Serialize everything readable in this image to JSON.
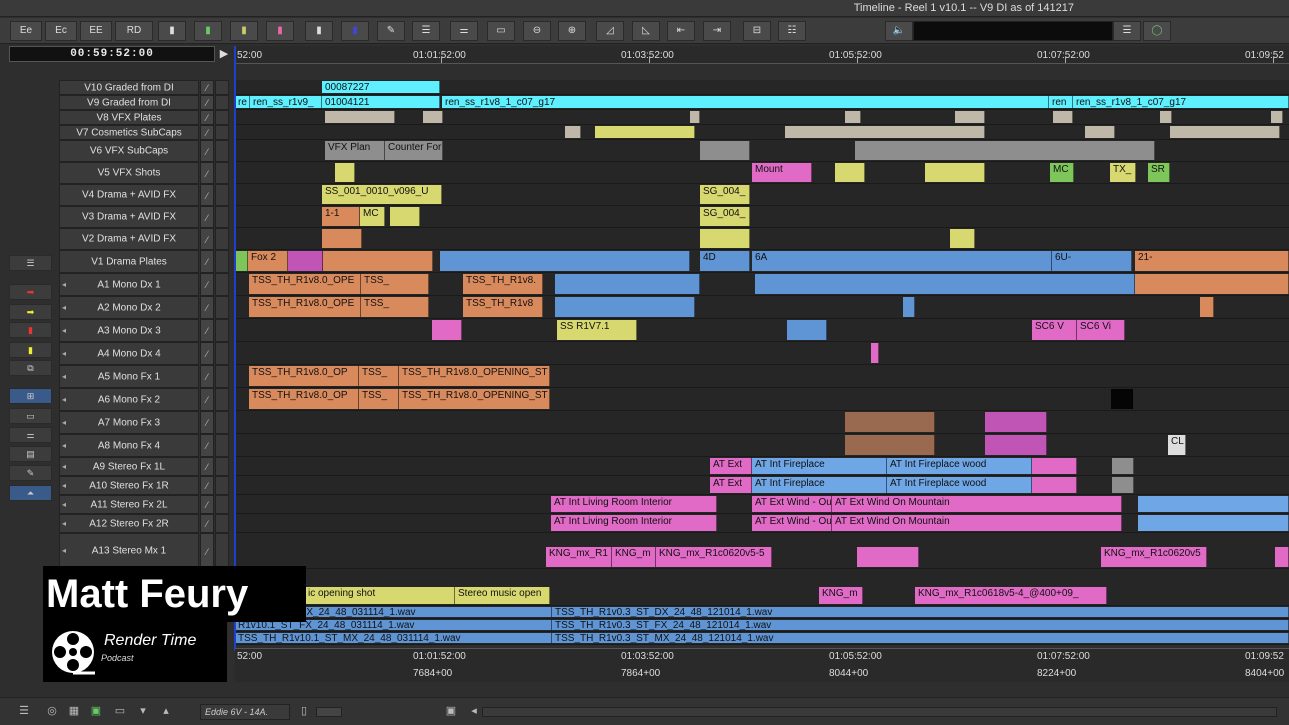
{
  "window": {
    "title": "Timeline - Reel 1 v10.1 -- V9 DI as of 141217"
  },
  "toolbar": {
    "buttons": [
      "Ee",
      "Ec",
      "EE",
      "RD"
    ]
  },
  "timecode": {
    "current": "00:59:52:00"
  },
  "ruler": {
    "labels": [
      "52:00",
      "01:01:52:00",
      "01:03:52:00",
      "01:05:52:00",
      "01:07:52:00",
      "01:09:52"
    ]
  },
  "ruler_bottom": {
    "labels": [
      "52:00",
      "01:01:52:00",
      "01:03:52:00",
      "01:05:52:00",
      "01:07:52:00",
      "01:09:52"
    ],
    "frames": [
      "7684+00",
      "7864+00",
      "8044+00",
      "8224+00",
      "8404+00"
    ]
  },
  "tracks": [
    {
      "name": "V10 Graded from DI"
    },
    {
      "name": "V9  Graded from DI"
    },
    {
      "name": "V8  VFX Plates"
    },
    {
      "name": "V7  Cosmetics SubCaps"
    },
    {
      "name": "V6  VFX SubCaps"
    },
    {
      "name": "V5  VFX Shots"
    },
    {
      "name": "V4  Drama + AVID FX"
    },
    {
      "name": "V3  Drama + AVID FX"
    },
    {
      "name": "V2  Drama + AVID FX"
    },
    {
      "name": "V1  Drama Plates"
    },
    {
      "name": "A1  Mono Dx 1"
    },
    {
      "name": "A2  Mono Dx 2"
    },
    {
      "name": "A3  Mono Dx 3"
    },
    {
      "name": "A4  Mono Dx 4"
    },
    {
      "name": "A5  Mono Fx 1"
    },
    {
      "name": "A6  Mono Fx 2"
    },
    {
      "name": "A7  Mono Fx 3"
    },
    {
      "name": "A8  Mono Fx 4"
    },
    {
      "name": "A9  Stereo Fx 1L"
    },
    {
      "name": "A10  Stereo Fx 1R"
    },
    {
      "name": "A11  Stereo Fx 2L"
    },
    {
      "name": "A12  Stereo Fx 2R"
    },
    {
      "name": "A13  Stereo Mx 1"
    }
  ],
  "clips": {
    "v10_a": "00087227",
    "v9_a": "re",
    "v9_b": "ren_ss_r1v9_",
    "v9_c": "01004121",
    "v9_d": "ren_ss_r1v8_1_c07_g17",
    "v9_e": "ren",
    "v9_f": "ren_ss_r1v8_1_c07_g17",
    "v6_a": "VFX Plan",
    "v6_b": "Counter For",
    "v5_a": "Mount",
    "v5_b": "MC",
    "v5_c": "TX_",
    "v5_d": "SR",
    "v4_a": "SS_001_0010_v096_U",
    "v4_b": "SG_004_",
    "v3_a": "1-1",
    "v3_b": "MC",
    "v3_c": "SG_004_",
    "v1_a": "Fox 2",
    "v1_b": "4D",
    "v1_c": "6A",
    "v1_d": "6U-",
    "v1_e": "21-",
    "a1_a": "TSS_TH_R1v8.0_OPE",
    "a1_b": "TSS_",
    "a1_c": "TSS_TH_R1v8.",
    "a2_a": "TSS_TH_R1v8.0_OPE",
    "a2_b": "TSS_",
    "a2_c": "TSS_TH_R1v8",
    "a3_a": "SS R1V7.1",
    "a3_b": "SC6 V",
    "a3_c": "SC6 Vi",
    "a5_a": "TSS_TH_R1v8.0_OP",
    "a5_b": "TSS_",
    "a5_c": "TSS_TH_R1v8.0_OPENING_ST",
    "a6_a": "TSS_TH_R1v8.0_OP",
    "a6_b": "TSS_",
    "a6_c": "TSS_TH_R1v8.0_OPENING_ST",
    "a8_a": "CL",
    "a9_a": "AT Ext",
    "a9_b": "AT Int Fireplace",
    "a9_c": "AT Int Fireplace wood",
    "a10_a": "AT Ext",
    "a10_b": "AT Int Fireplace",
    "a10_c": "AT Int Fireplace wood",
    "a11_a": "AT Int Living Room Interior",
    "a11_b": "AT Ext Wind - Ou",
    "a11_c": "AT Ext Wind On Mountain",
    "a12_a": "AT Int Living Room Interior",
    "a12_b": "AT Ext Wind - Ou",
    "a12_c": "AT Ext Wind On Mountain",
    "a13_a": "KNG_mx_R1",
    "a13_b": "KNG_m",
    "a13_c": "KNG_mx_R1c0620v5-5",
    "a13_d": "KNG_mx_R1c0620v5",
    "a14_a": "ic opening shot",
    "a14_b": "Stereo music open",
    "a14_c": "KNG_m",
    "a14_d": "KNG_mx_R1c0618v5-4_@400+09_",
    "a15_a": "R1v10.1_ST_DX_24_48_031114_1.wav",
    "a15_b": "TSS_TH_R1v0.3_ST_DX_24_48_121014_1.wav",
    "a16_a": "R1v10.1_ST_FX_24_48_031114_1.wav",
    "a16_b": "TSS_TH_R1v0.3_ST_FX_24_48_121014_1.wav",
    "a17_a": "TSS_TH_R1v10.1_ST_MX_24_48_031114_1.wav",
    "a17_b": "TSS_TH_R1v0.3_ST_MX_24_48_121014_1.wav"
  },
  "overlay": {
    "name": "Matt Feury",
    "podcast": "Render Time",
    "podcast_sub": "Podcast"
  },
  "bottom": {
    "label": "Eddie 6V - 14A."
  }
}
